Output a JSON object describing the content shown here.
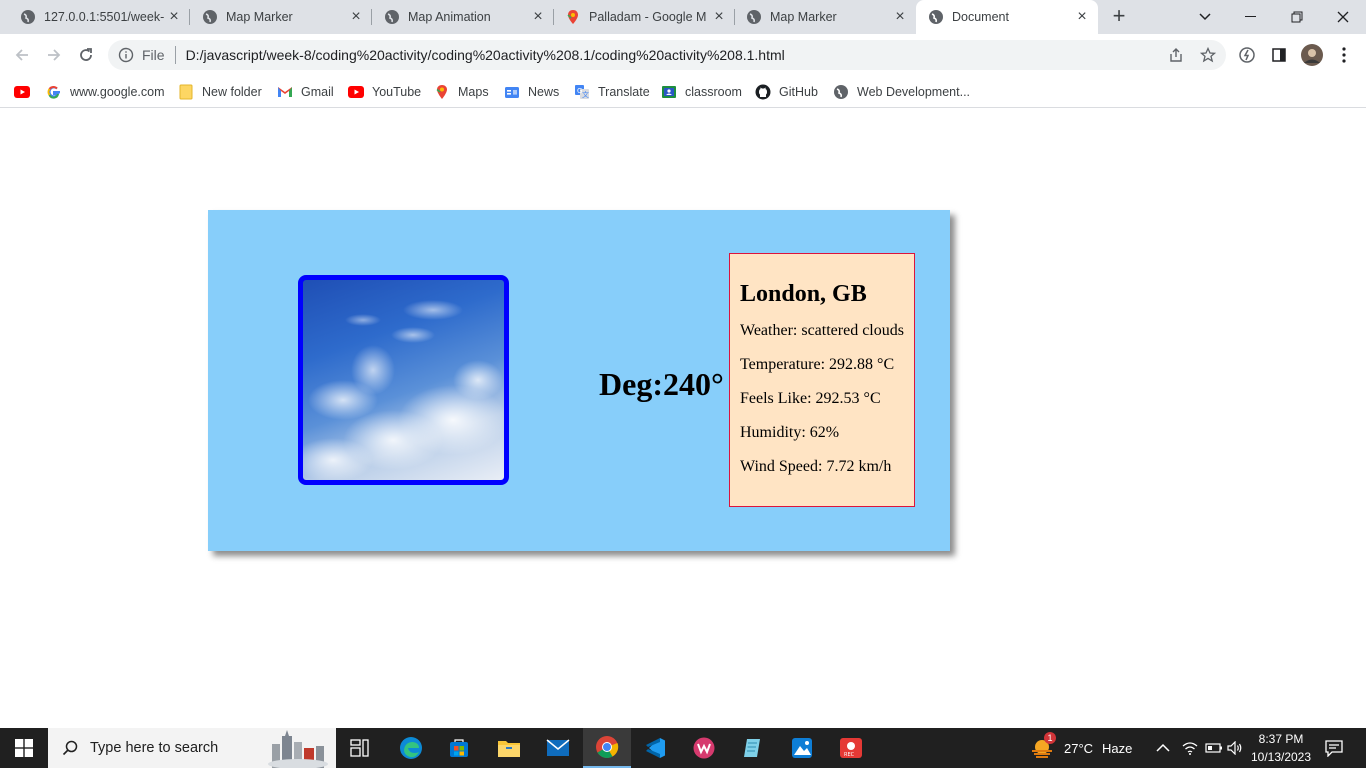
{
  "tabs": [
    {
      "title": "127.0.0.1:5501/week-",
      "icon": "globe-icon",
      "active": false
    },
    {
      "title": "Map Marker",
      "icon": "globe-icon",
      "active": false
    },
    {
      "title": "Map Animation",
      "icon": "globe-icon",
      "active": false
    },
    {
      "title": "Palladam - Google M",
      "icon": "google-maps-icon",
      "active": false
    },
    {
      "title": "Map Marker",
      "icon": "globe-icon",
      "active": false
    },
    {
      "title": "Document",
      "icon": "globe-icon",
      "active": true
    }
  ],
  "address_bar": {
    "scheme_label": "File",
    "url": "D:/javascript/week-8/coding%20activity/coding%20activity%208.1/coding%20activity%208.1.html"
  },
  "bookmarks": [
    {
      "label": "",
      "icon": "youtube-icon"
    },
    {
      "label": "www.google.com",
      "icon": "google-icon"
    },
    {
      "label": "New folder",
      "icon": "folder-icon"
    },
    {
      "label": "Gmail",
      "icon": "gmail-icon"
    },
    {
      "label": "YouTube",
      "icon": "youtube-icon"
    },
    {
      "label": "Maps",
      "icon": "google-maps-icon"
    },
    {
      "label": "News",
      "icon": "news-icon"
    },
    {
      "label": "Translate",
      "icon": "translate-icon"
    },
    {
      "label": "classroom",
      "icon": "classroom-icon"
    },
    {
      "label": "GitHub",
      "icon": "github-icon"
    },
    {
      "label": "Web Development...",
      "icon": "globe-icon"
    }
  ],
  "weather": {
    "deg_text": "Deg:240°",
    "city": "London, GB",
    "weather": "Weather: scattered clouds",
    "temperature": "Temperature: 292.88 °C",
    "feels_like": "Feels Like: 292.53 °C",
    "humidity": "Humidity: 62%",
    "wind_speed": "Wind Speed: 7.72 km/h"
  },
  "colors": {
    "card_background": "#87cefa",
    "image_border": "#0000ff",
    "info_background": "#ffe4c4",
    "info_border": "#dc143c"
  },
  "taskbar": {
    "search_placeholder": "Type here to search",
    "weather_temp": "27°C",
    "weather_desc": "Haze",
    "weather_badge": "1",
    "time": "8:37 PM",
    "date": "10/13/2023"
  }
}
